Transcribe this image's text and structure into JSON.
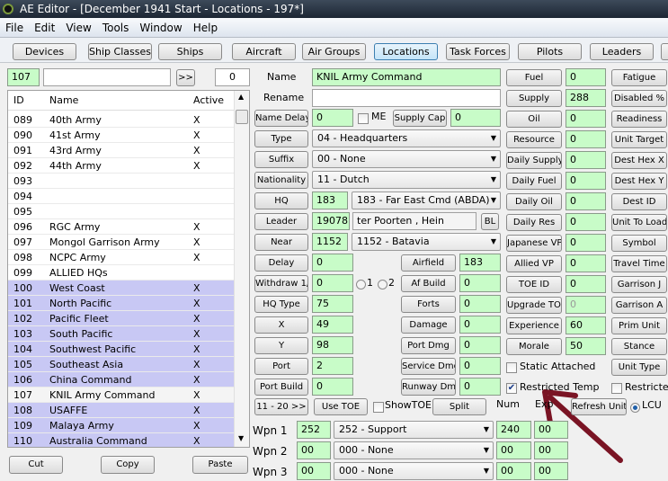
{
  "window": {
    "title": "AE Editor - [December 1941 Start - Locations - 197*]"
  },
  "menu": [
    "File",
    "Edit",
    "View",
    "Tools",
    "Window",
    "Help"
  ],
  "toolbar": [
    "Devices",
    "Ship Classes",
    "Ships",
    "Aircraft",
    "Air Groups",
    "Locations",
    "Task Forces",
    "Pilots",
    "Leaders"
  ],
  "toolbar_selected": "Locations",
  "search": {
    "id_value": "107",
    "text_value": "",
    "go_label": ">>",
    "count_value": "0"
  },
  "list": {
    "columns": [
      "ID",
      "Name",
      "Active"
    ],
    "rows": [
      {
        "id": "089",
        "name": "40th Army",
        "active": "X"
      },
      {
        "id": "090",
        "name": "41st Army",
        "active": "X"
      },
      {
        "id": "091",
        "name": "43rd Army",
        "active": "X"
      },
      {
        "id": "092",
        "name": "44th Army",
        "active": "X"
      },
      {
        "id": "093",
        "name": "",
        "active": ""
      },
      {
        "id": "094",
        "name": "",
        "active": ""
      },
      {
        "id": "095",
        "name": "",
        "active": ""
      },
      {
        "id": "096",
        "name": "RGC Army",
        "active": "X"
      },
      {
        "id": "097",
        "name": "Mongol Garrison Army",
        "active": "X"
      },
      {
        "id": "098",
        "name": "NCPC Army",
        "active": "X"
      },
      {
        "id": "099",
        "name": "ALLIED HQs",
        "active": ""
      },
      {
        "id": "100",
        "name": "West Coast",
        "active": "X",
        "highlighted": true
      },
      {
        "id": "101",
        "name": "North Pacific",
        "active": "X",
        "highlighted": true
      },
      {
        "id": "102",
        "name": "Pacific Fleet",
        "active": "X",
        "highlighted": true
      },
      {
        "id": "103",
        "name": "South Pacific",
        "active": "X",
        "highlighted": true
      },
      {
        "id": "104",
        "name": "Southwest Pacific",
        "active": "X",
        "highlighted": true
      },
      {
        "id": "105",
        "name": "Southeast Asia",
        "active": "X",
        "highlighted": true
      },
      {
        "id": "106",
        "name": "China Command",
        "active": "X",
        "highlighted": true
      },
      {
        "id": "107",
        "name": "KNIL Army Command",
        "active": "X",
        "selected": true
      },
      {
        "id": "108",
        "name": "USAFFE",
        "active": "X",
        "highlighted": true
      },
      {
        "id": "109",
        "name": "Malaya Army",
        "active": "X",
        "highlighted": true
      },
      {
        "id": "110",
        "name": "Australia Command",
        "active": "X",
        "highlighted": true
      }
    ],
    "highlight_color": "#c8c8f4"
  },
  "list_buttons": {
    "cut": "Cut",
    "copy": "Copy",
    "paste": "Paste"
  },
  "form": {
    "name_label": "Name",
    "name_value": "KNIL Army Command",
    "rename_label": "Rename",
    "rename_value": "",
    "name_delay": {
      "label": "Name Delay",
      "value": "0"
    },
    "me_label": "ME",
    "me_checked": false,
    "supply_cap": {
      "label": "Supply Cap",
      "value": "0"
    },
    "type": {
      "label": "Type",
      "value": "04 - Headquarters"
    },
    "suffix": {
      "label": "Suffix",
      "value": "00 - None"
    },
    "nationality": {
      "label": "Nationality",
      "value": "11 - Dutch"
    },
    "hq": {
      "label": "HQ",
      "id": "183",
      "value": "183 - Far East Cmd (ABDA)"
    },
    "leader": {
      "label": "Leader",
      "id": "19078",
      "value": "ter Poorten , Hein",
      "bl": "BL"
    },
    "near": {
      "label": "Near",
      "id": "1152",
      "value": "1152 - Batavia"
    },
    "delay": {
      "label": "Delay",
      "value": "0"
    },
    "withdraw": {
      "label": "Withdraw 1/2",
      "value": "0",
      "radio1": "1",
      "radio2": "2"
    },
    "hq_type": {
      "label": "HQ Type",
      "value": "75"
    },
    "x": {
      "label": "X",
      "value": "49"
    },
    "y": {
      "label": "Y",
      "value": "98"
    },
    "port": {
      "label": "Port",
      "value": "2"
    },
    "port_build": {
      "label": "Port Build",
      "value": "0"
    },
    "airfield": {
      "label": "Airfield",
      "value": "183"
    },
    "af_build": {
      "label": "Af Build",
      "value": "0"
    },
    "forts": {
      "label": "Forts",
      "value": "0"
    },
    "damage": {
      "label": "Damage",
      "value": "0"
    },
    "port_dmg": {
      "label": "Port Dmg",
      "value": "0"
    },
    "service_dmg": {
      "label": "Service Dmg",
      "value": "0"
    },
    "runway_dmg": {
      "label": "Runway Dmg",
      "value": "0"
    },
    "fuel": {
      "label": "Fuel",
      "value": "0"
    },
    "supply": {
      "label": "Supply",
      "value": "288"
    },
    "oil": {
      "label": "Oil",
      "value": "0"
    },
    "resource": {
      "label": "Resource",
      "value": "0"
    },
    "daily_supply": {
      "label": "Daily Supply",
      "value": "0"
    },
    "daily_fuel": {
      "label": "Daily Fuel",
      "value": "0"
    },
    "daily_oil": {
      "label": "Daily Oil",
      "value": "0"
    },
    "daily_res": {
      "label": "Daily Res",
      "value": "0"
    },
    "japanese_vp": {
      "label": "Japanese VP",
      "value": "0"
    },
    "allied_vp": {
      "label": "Allied VP",
      "value": "0"
    },
    "toe_id": {
      "label": "TOE ID",
      "value": "0"
    },
    "upgrade_toe": {
      "label": "Upgrade TOE",
      "value": "0"
    },
    "experience": {
      "label": "Experience",
      "value": "60"
    },
    "morale": {
      "label": "Morale",
      "value": "50"
    },
    "static_attached": {
      "label": "Static Attached",
      "checked": false
    },
    "restricted_temp": {
      "label": "Restricted Temp",
      "checked": true
    },
    "restricted_p": {
      "label": "Restricted P",
      "checked": false
    },
    "right_buttons": [
      "Fatigue",
      "Disabled %",
      "Readiness",
      "Unit Target",
      "Dest Hex X",
      "Dest Hex Y",
      "Dest ID",
      "Unit To Load",
      "Symbol",
      "Travel Time",
      "Garrison J",
      "Garrison A",
      "Prim Unit",
      "Stance",
      "Unit Type"
    ],
    "next_page": "11 - 20 >>",
    "use_toe": "Use TOE",
    "show_toe": "ShowTOE",
    "show_toe_checked": false,
    "split": "Split",
    "num_header": "Num",
    "exp_header": "Exp",
    "refresh_units": "Refresh Units",
    "lcu_label": "LCU",
    "lcu_selected": true,
    "weapons": [
      {
        "label": "Wpn 1",
        "id": "252",
        "value": "252 - Support",
        "num": "240",
        "exp": "00"
      },
      {
        "label": "Wpn 2",
        "id": "00",
        "value": "000 - None",
        "num": "00",
        "exp": "00"
      },
      {
        "label": "Wpn 3",
        "id": "00",
        "value": "000 - None",
        "num": "00",
        "exp": "00"
      }
    ]
  },
  "annotation": {
    "arrow_color": "#7a1424"
  }
}
